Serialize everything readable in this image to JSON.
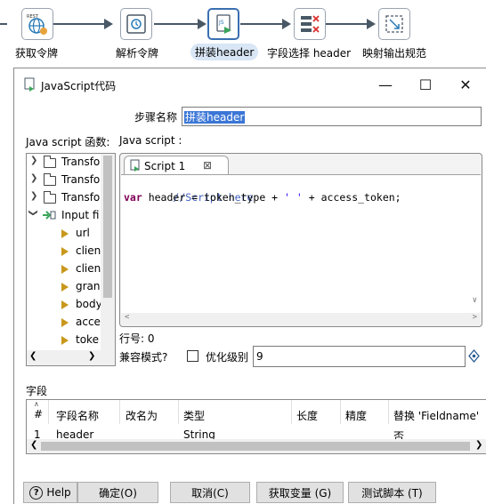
{
  "pipeline": {
    "steps": [
      {
        "label": "获取令牌",
        "icon": "rest-globe-icon"
      },
      {
        "label": "解析令牌",
        "icon": "json-parse-icon"
      },
      {
        "label": "拼装header",
        "icon": "javascript-icon",
        "active": true
      },
      {
        "label": "字段选择 header",
        "icon": "select-values-icon"
      },
      {
        "label": "映射输出规范",
        "icon": "mapping-output-icon"
      }
    ]
  },
  "dialog": {
    "title": "JavaScript代码",
    "minimize": "—",
    "maximize": "☐",
    "close": "✕",
    "step_name_label": "步骤名称",
    "step_name_value": "拼装header",
    "functions_label": "Java script 函数:",
    "script_label": "Java script :",
    "tree": [
      {
        "type": "folder",
        "label": "Transfo"
      },
      {
        "type": "folder",
        "label": "Transfo"
      },
      {
        "type": "folder",
        "label": "Transfo"
      },
      {
        "type": "input",
        "label": "Input fi"
      },
      {
        "type": "field",
        "label": "url"
      },
      {
        "type": "field",
        "label": "clien"
      },
      {
        "type": "field",
        "label": "clien"
      },
      {
        "type": "field",
        "label": "gran"
      },
      {
        "type": "field",
        "label": "body"
      },
      {
        "type": "field",
        "label": "acce"
      },
      {
        "type": "field",
        "label": "toke"
      }
    ],
    "editor": {
      "tab_label": "Script 1",
      "tab_close": "⊠",
      "line1_comment": "//Script here",
      "line2_kw": "var",
      "line2_a": " header = token_type + ",
      "line2_str": "' '",
      "line2_b": " + access_token;"
    },
    "line_number": "行号: 0",
    "compat_label": "兼容模式?",
    "optimization_label": "优化级别",
    "optimization_value": "9",
    "fields_label": "字段",
    "fields": {
      "columns": [
        "#",
        "字段名称",
        "改名为",
        "类型",
        "长度",
        "精度",
        "替换 'Fieldname'"
      ],
      "rows": [
        [
          "1",
          "header",
          "",
          "String",
          "",
          "",
          "否"
        ]
      ]
    },
    "buttons": {
      "help": "Help",
      "ok": "确定(O)",
      "cancel": "取消(C)",
      "get_vars": "获取变量 (G)",
      "test_script": "测试脚本 (T)"
    }
  }
}
